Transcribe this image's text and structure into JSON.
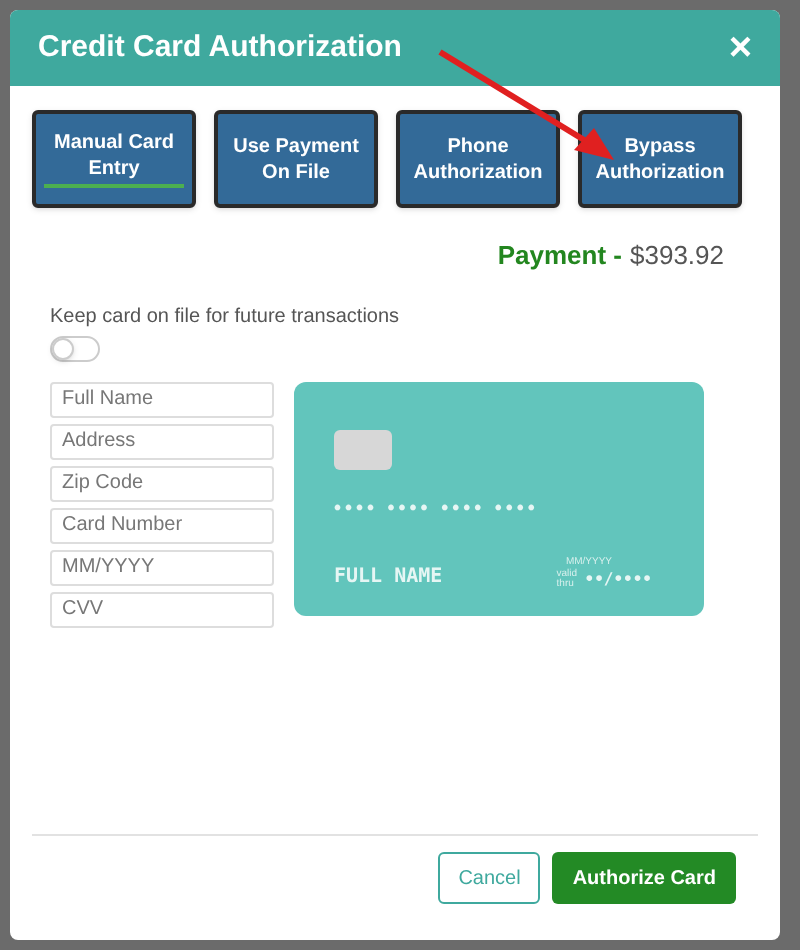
{
  "dialog": {
    "title": "Credit Card Authorization",
    "close": "×"
  },
  "options": [
    {
      "label": "Manual Card Entry",
      "selected": true
    },
    {
      "label": "Use Payment On File",
      "selected": false
    },
    {
      "label": "Phone Authorization",
      "selected": false
    },
    {
      "label": "Bypass Authorization",
      "selected": false
    }
  ],
  "payment": {
    "label": "Payment -",
    "amount": "$393.92"
  },
  "keep_on_file": {
    "label": "Keep card on file for future transactions",
    "on": false
  },
  "fields": [
    {
      "placeholder": "Full Name"
    },
    {
      "placeholder": "Address"
    },
    {
      "placeholder": "Zip Code"
    },
    {
      "placeholder": "Card Number"
    },
    {
      "placeholder": "MM/YYYY"
    },
    {
      "placeholder": "CVV"
    }
  ],
  "card_preview": {
    "number": "•••• •••• •••• ••••",
    "name": "FULL NAME",
    "expiry_caption": "MM/YYYY",
    "valid_label": "valid thru",
    "expiry": "••/••••"
  },
  "buttons": {
    "cancel": "Cancel",
    "submit": "Authorize Card"
  }
}
